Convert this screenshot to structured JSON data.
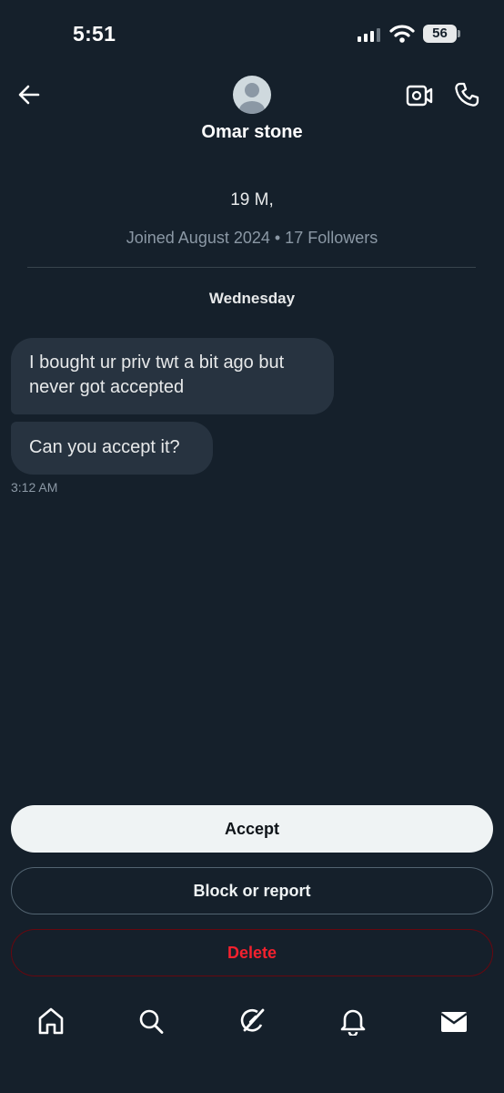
{
  "status_bar": {
    "time": "5:51",
    "battery": "56"
  },
  "header": {
    "name": "Omar stone"
  },
  "profile": {
    "bio": "19 M,",
    "joined": "Joined August 2024 • 17 Followers"
  },
  "conversation": {
    "day": "Wednesday",
    "messages": [
      {
        "text": "I bought ur priv twt a bit ago but never got accepted"
      },
      {
        "text": "Can you accept it?"
      }
    ],
    "timestamp": "3:12 AM"
  },
  "actions": {
    "accept": "Accept",
    "block": "Block or report",
    "delete": "Delete"
  },
  "icons": {
    "back": "arrow-left-icon",
    "video": "video-camera-icon",
    "phone": "phone-icon",
    "home": "home-icon",
    "search": "search-icon",
    "grok": "grok-icon",
    "notifications": "bell-icon",
    "messages": "envelope-icon"
  },
  "colors": {
    "background": "#15202b",
    "bubble": "#273340",
    "danger": "#f4212e",
    "accept_bg": "#eff3f4"
  }
}
